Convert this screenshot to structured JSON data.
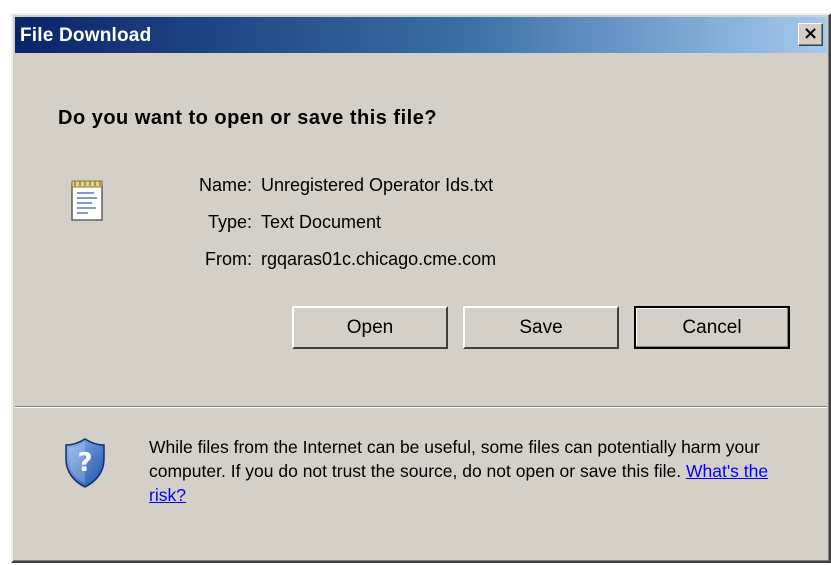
{
  "window": {
    "title": "File Download",
    "close_label": "×"
  },
  "prompt": {
    "question": "Do you want to open or save this file?"
  },
  "file_info": {
    "name_label": "Name:",
    "name_value": "Unregistered Operator Ids.txt",
    "type_label": "Type:",
    "type_value": "Text Document",
    "from_label": "From:",
    "from_value": "rgqaras01c.chicago.cme.com"
  },
  "buttons": {
    "open": "Open",
    "save": "Save",
    "cancel": "Cancel"
  },
  "warning": {
    "text": "While files from the Internet can be useful, some files can potentially harm your computer. If you do not trust the source, do not open or save this file.",
    "link": "What's the risk?"
  },
  "icons": {
    "file": "text-document-icon",
    "shield": "shield-question-icon"
  },
  "colors": {
    "titlebar_start": "#0a246a",
    "titlebar_end": "#a6caf0",
    "dialog_bg": "#d4d0c8",
    "link": "#0000ff"
  }
}
